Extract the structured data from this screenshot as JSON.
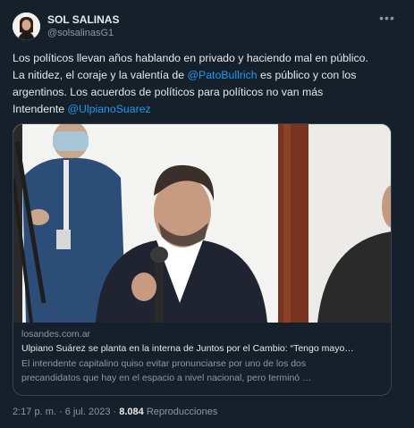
{
  "author": {
    "name": "SOL SALINAS",
    "handle": "@solsalinasG1"
  },
  "menu_icon": "more-horizontal-icon",
  "tweet_text": {
    "line1": "Los políticos llevan años hablando en privado y haciendo mal en público.",
    "line2_before": "La nitidez, el coraje y la valentía de ",
    "mention1": "@PatoBullrich",
    "line2_after": " es público y con los",
    "line3": "argentinos. Los acuerdos de políticos para políticos no van más",
    "line4_before": "Intendente ",
    "mention2": "@UlpianoSuarez"
  },
  "card": {
    "domain": "losandes.com.ar",
    "title": "Ulpiano Suárez se planta en la interna de Juntos por el Cambio: “Tengo mayo…",
    "desc_line1": "El intendente capitalino quiso evitar pronunciarse por uno de los dos",
    "desc_line2": "precandidatos que hay en el espacio a nivel nacional, pero terminó …"
  },
  "footer": {
    "time": "2:17 p. m. · 6 jul. 2023 · ",
    "views_count": "8.084",
    "views_label": " Reproducciones"
  },
  "colors": {
    "background": "#15202b",
    "link": "#1d9bf0",
    "muted": "#8b98a5",
    "border": "#38444d"
  }
}
